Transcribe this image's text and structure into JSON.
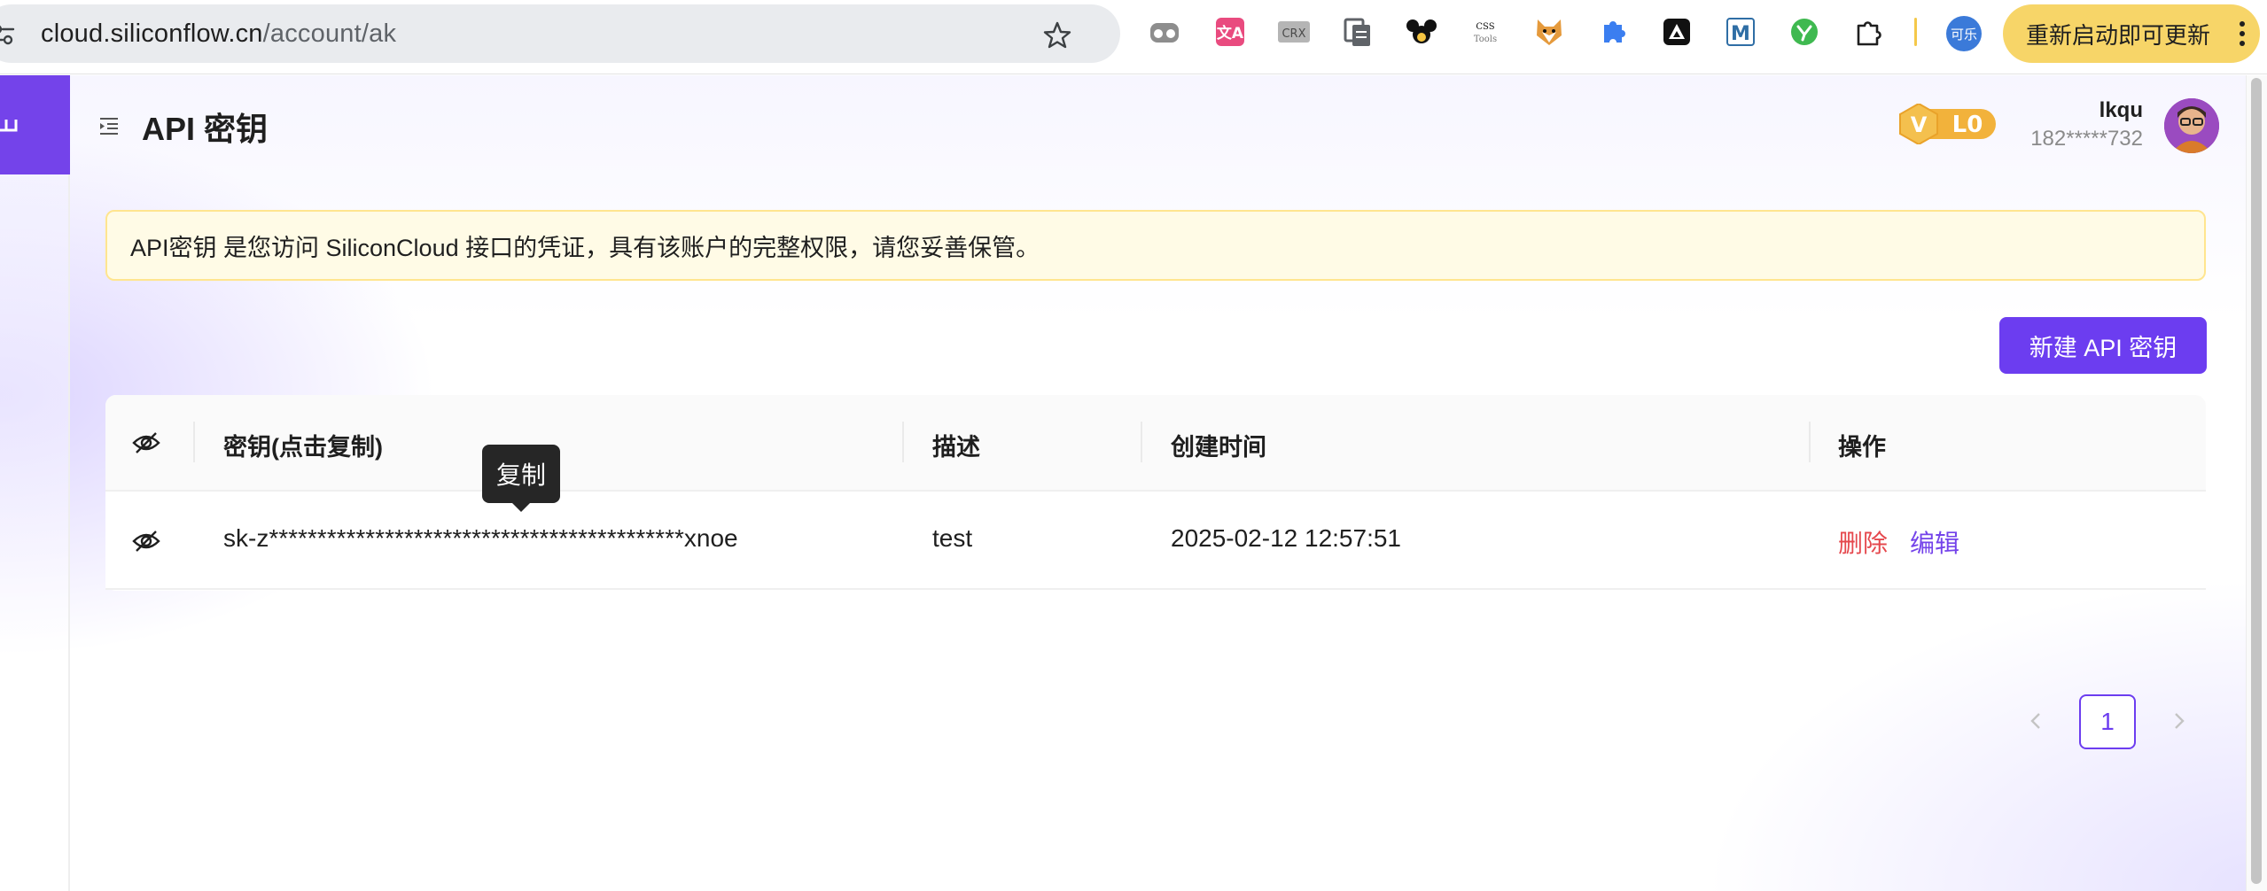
{
  "browser": {
    "url_host": "cloud.siliconflow.cn",
    "url_path": "/account/ak",
    "extensions": [
      "dual-circles-icon",
      "translate-icon",
      "crx-icon",
      "copy-stack-icon",
      "mouse-ears-icon",
      "css-tools-icon",
      "shiba-icon",
      "puzzle-icon",
      "dark-triangle-icon",
      "m-icon",
      "green-check-icon",
      "extensions-menu-icon"
    ],
    "crx_text": "CRX",
    "css_tools_text": "CSS\nTools",
    "profile_label": "可乐",
    "update_label": "重新启动即可更新"
  },
  "header": {
    "title": "API 密钥",
    "vip_level": "L0",
    "vip_letter": "V",
    "user_name": "lkqu",
    "user_phone": "182*****732"
  },
  "alert": {
    "text": "API密钥 是您访问 SiliconCloud 接口的凭证，具有该账户的完整权限，请您妥善保管。"
  },
  "toolbar": {
    "new_key_label": "新建 API 密钥"
  },
  "table": {
    "columns": [
      "密钥(点击复制)",
      "描述",
      "创建时间",
      "操作"
    ],
    "rows": [
      {
        "key": "sk-z*******************************************xnoe",
        "description": "test",
        "created_at": "2025-02-12 12:57:51",
        "delete_label": "删除",
        "edit_label": "编辑"
      }
    ]
  },
  "tooltip": {
    "text": "复制"
  },
  "pagination": {
    "current_page": "1"
  },
  "colors": {
    "accent": "#6c3df0",
    "danger": "#e5484d",
    "alert_bg": "#fffbe6",
    "update_chip": "#f7d568"
  }
}
